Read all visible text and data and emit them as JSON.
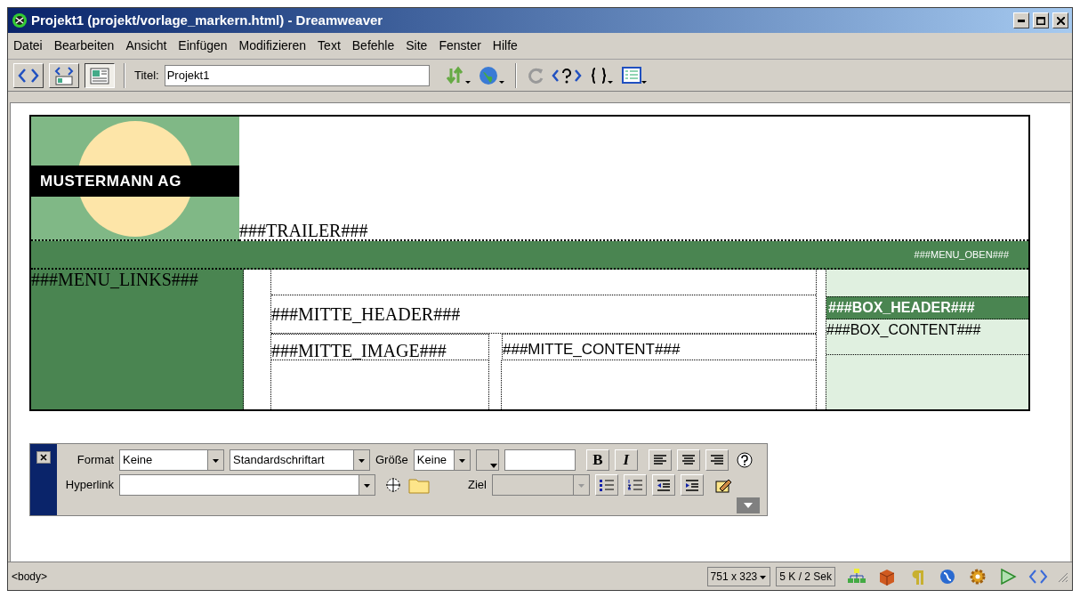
{
  "window": {
    "title": "Projekt1 (projekt/vorlage_markern.html) - Dreamweaver"
  },
  "menu": [
    "Datei",
    "Bearbeiten",
    "Ansicht",
    "Einfügen",
    "Modifizieren",
    "Text",
    "Befehle",
    "Site",
    "Fenster",
    "Hilfe"
  ],
  "toolbar": {
    "view_buttons": [
      {
        "selected": false
      },
      {
        "selected": false
      },
      {
        "selected": true
      }
    ],
    "title_label": "Titel:",
    "title_value": "Projekt1"
  },
  "design": {
    "logo_text": "MUSTERMANN AG",
    "trailer": "###TRAILER###",
    "menu_oben": "###MENU_OBEN###",
    "menu_links": "###MENU_LINKS###",
    "mitte_header": "###MITTE_HEADER###",
    "mitte_image": "###MITTE_IMAGE###",
    "mitte_content": "###MITTE_CONTENT###",
    "box_header": "###BOX_HEADER###",
    "box_content": "###BOX_CONTENT###"
  },
  "properties": {
    "format_label": "Format",
    "format_value": "Keine",
    "font_value": "Standardschriftart",
    "size_label": "Größe",
    "size_value": "Keine",
    "bold": "B",
    "italic": "I",
    "hyperlink_label": "Hyperlink",
    "target_label": "Ziel"
  },
  "status_bar": {
    "tag": "<body>",
    "window_size": "751 x 323",
    "download": "5 K / 2 Sek"
  }
}
